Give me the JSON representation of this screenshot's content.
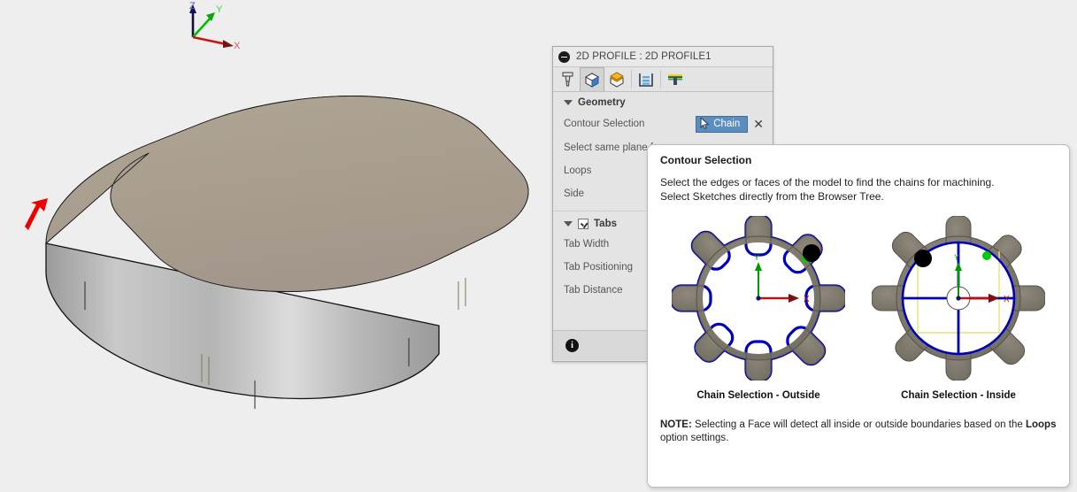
{
  "viewport": {
    "triad": {
      "x_label": "X",
      "y_label": "Y",
      "z_label": "Z",
      "x_color": "#cc1111",
      "y_color": "#00bb00",
      "z_color": "#111166"
    },
    "model": {
      "name": "rounded-rectangular-plate",
      "top_face_color": "#a89e8c",
      "side_face_color": "#b3b3b3",
      "selected_contour_color": "#0000ee",
      "annotation_arrow_color": "#ee0000"
    }
  },
  "dialog": {
    "title": "2D PROFILE : 2D PROFILE1",
    "collapse_icon": "minus-circle-icon",
    "tabs": [
      {
        "name": "tool-tab",
        "icon": "endmill-tool-icon",
        "active": false
      },
      {
        "name": "geometry-tab",
        "icon": "geometry-box-icon",
        "active": true
      },
      {
        "name": "heights-tab",
        "icon": "heights-box-icon",
        "active": false
      },
      {
        "name": "passes-tab",
        "icon": "passes-layers-icon",
        "active": false
      },
      {
        "name": "linking-tab",
        "icon": "linking-ramp-icon",
        "active": false
      }
    ],
    "geometry": {
      "section_label": "Geometry",
      "rows": [
        {
          "label": "Contour Selection",
          "control": "chain-button"
        },
        {
          "label": "Select same plane f",
          "control": "none"
        },
        {
          "label": "Loops",
          "control": "none"
        },
        {
          "label": "Side",
          "control": "none"
        }
      ],
      "chain_button_label": "Chain",
      "chain_button_icon": "cursor-arrow-icon",
      "chain_button_color": "#5b8ebe",
      "clear_selection_label": "✕"
    },
    "tabs_section": {
      "section_label": "Tabs",
      "checked": true,
      "rows": [
        {
          "label": "Tab Width"
        },
        {
          "label": "Tab Positioning"
        },
        {
          "label": "Tab Distance"
        }
      ]
    },
    "footer": {
      "info_icon": "info-circle-icon",
      "info_glyph": "i"
    }
  },
  "tooltip": {
    "title": "Contour Selection",
    "body_line1": "Select the edges or faces of the model to find the chains for machining.",
    "body_line2": "Select Sketches directly from the Browser Tree.",
    "figures": [
      {
        "name": "chain-selection-outside-figure",
        "caption": "Chain Selection - Outside",
        "mode": "outside"
      },
      {
        "name": "chain-selection-inside-figure",
        "caption": "Chain Selection - Inside",
        "mode": "inside"
      }
    ],
    "note_prefix": "NOTE:",
    "note_text_1": " Selecting a Face will detect all inside or outside boundaries based on the ",
    "note_bold": "Loops",
    "note_text_2": " option settings.",
    "gear_body_color": "#7f7a6e",
    "highlight_color": "#0000bb",
    "marker_black": "#000000",
    "marker_green": "#00cc00",
    "bbox_color": "#e8e87a"
  }
}
